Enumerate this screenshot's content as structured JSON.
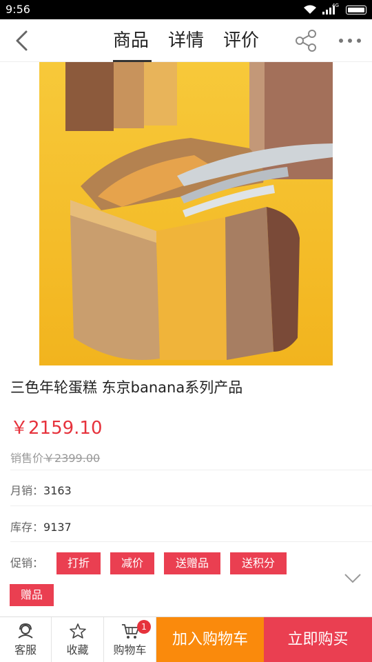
{
  "status_bar": {
    "time": "9:56",
    "network_tag": "4G"
  },
  "nav": {
    "tabs": [
      {
        "label": "商品",
        "active": true
      },
      {
        "label": "详情",
        "active": false
      },
      {
        "label": "评价",
        "active": false
      }
    ],
    "icons": {
      "back": "back-icon",
      "share": "share-icon",
      "more": "more-icon"
    }
  },
  "product": {
    "image_icon": "product-photo",
    "title": "三色年轮蛋糕 东京banana系列产品",
    "price": "￥2159.10",
    "original_label": "销售价",
    "original_price": "￥2399.00",
    "monthly_sales_label": "月销：",
    "monthly_sales": "3163",
    "stock_label": "库存：",
    "stock": "9137",
    "promo_label": "促销：",
    "promos": [
      "打折",
      "减价",
      "送赠品",
      "送积分",
      "赠品"
    ]
  },
  "bottom_bar": {
    "service": "客服",
    "favorite": "收藏",
    "cart": "购物车",
    "cart_count": "1",
    "add_to_cart": "加入购物车",
    "buy_now": "立即购买"
  },
  "colors": {
    "price": "#e6323c",
    "promo_tag": "#ea3f51",
    "add_to_cart": "#fa8a0c",
    "buy_now": "#ea3f51"
  }
}
